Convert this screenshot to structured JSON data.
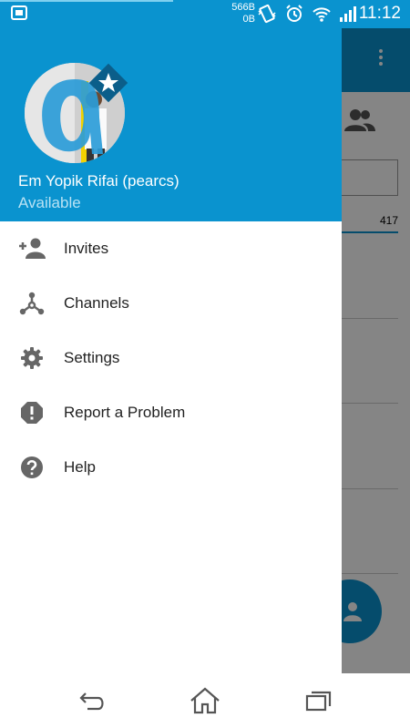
{
  "status_bar": {
    "net_up": "566B",
    "net_down": "0B",
    "time": "11:12",
    "color": "#0a93cf"
  },
  "drawer": {
    "user_name": "Em Yopik Rifai (pearcs)",
    "user_status": "Available",
    "header_color": "#0a93cf",
    "menu": [
      {
        "label": "Invites",
        "icon": "add-person-icon"
      },
      {
        "label": "Channels",
        "icon": "channels-icon"
      },
      {
        "label": "Settings",
        "icon": "gear-icon"
      },
      {
        "label": "Report a Problem",
        "icon": "alert-icon"
      },
      {
        "label": "Help",
        "icon": "help-icon"
      }
    ]
  },
  "background_app": {
    "count": "417"
  },
  "navbar": {
    "buttons": [
      "back-icon",
      "home-icon",
      "recents-icon"
    ]
  }
}
